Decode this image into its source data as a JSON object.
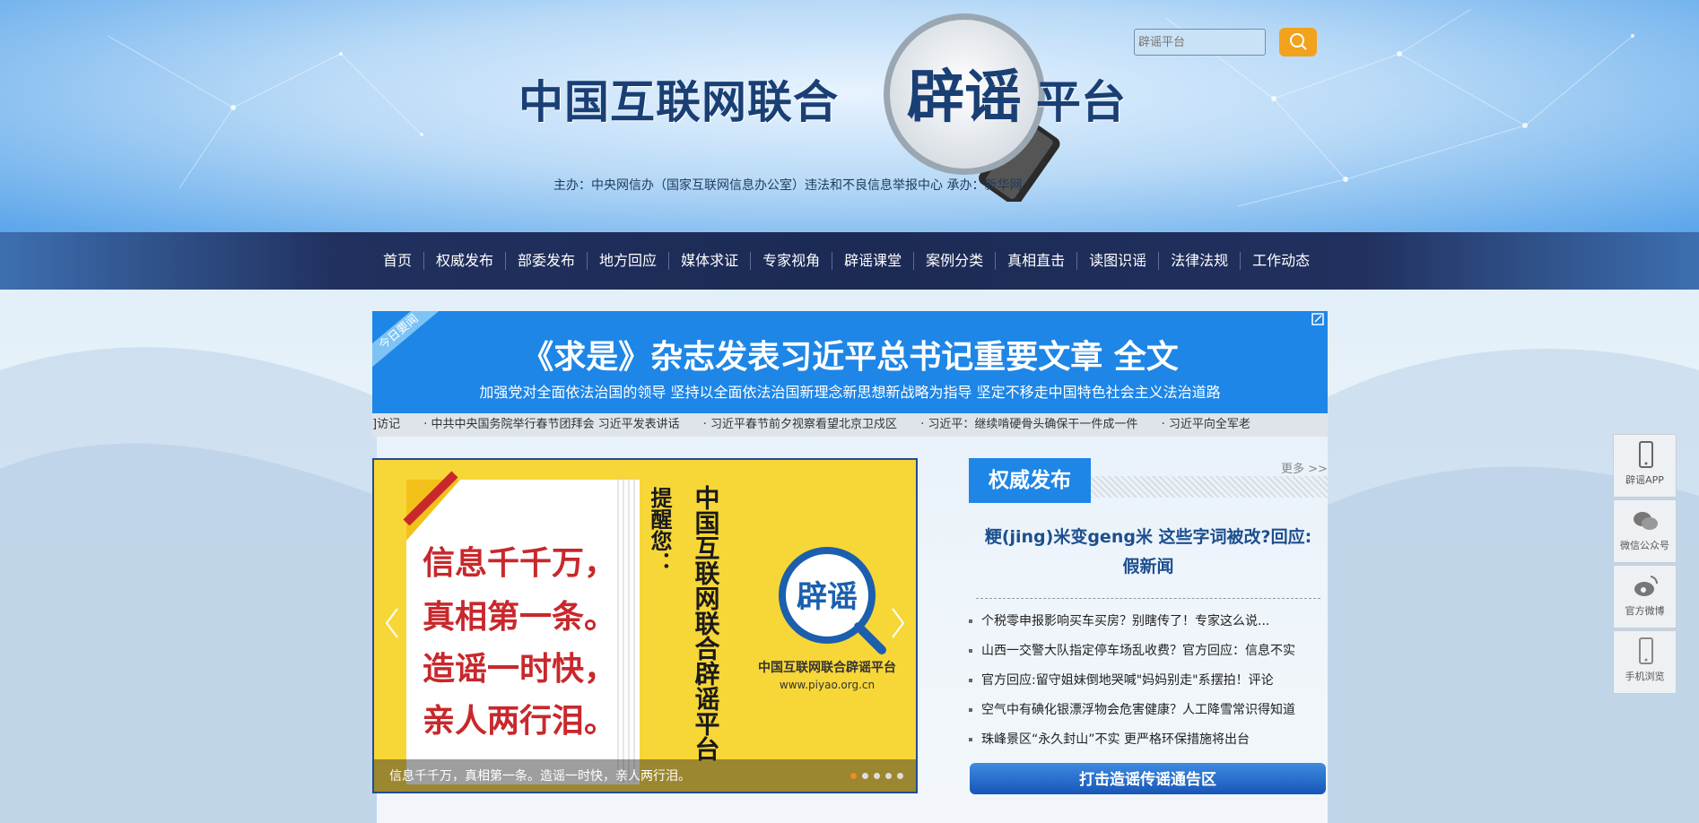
{
  "header": {
    "logo_left": "中国互联网联合",
    "logo_mid": "辟谣",
    "logo_right": "平台",
    "sponsor": "主办：中央网信办（国家互联网信息办公室）违法和不良信息举报中心    承办：新华网",
    "search_placeholder": "辟谣平台"
  },
  "nav": {
    "items": [
      "首页",
      "权威发布",
      "部委发布",
      "地方回应",
      "媒体求证",
      "专家视角",
      "辟谣课堂",
      "案例分类",
      "真相直击",
      "读图识谣",
      "法律法规",
      "工作动态"
    ]
  },
  "headline": {
    "ribbon": "今日要闻",
    "title": "《求是》杂志发表习近平总书记重要文章 全文",
    "subtitle": "加强党对全面依法治国的领导 坚持以全面依法治国新理念新思想新战略为指导 坚定不移走中国特色社会主义法治道路"
  },
  "ticker": {
    "items": [
      "]访记",
      "·  中共中央国务院举行春节团拜会 习近平发表讲话",
      "·  习近平春节前夕视察看望北京卫戍区",
      "·  习近平：继续啃硬骨头确保干一件成一件",
      "·  习近平向全军老"
    ]
  },
  "slider": {
    "caption": "信息千千万，真相第一条。造谣一时快，亲人两行泪。",
    "poster_lines": [
      "信息千千万，",
      "真相第一条。",
      "造谣一时快，",
      "亲人两行泪。"
    ],
    "reminder": "提醒您：",
    "vertical_org": "中国互联网联合辟谣平台",
    "badge": "辟谣",
    "badge_org": "中国互联网联合辟谣平台",
    "badge_url": "www.piyao.org.cn",
    "active_dot": 0,
    "dot_count": 5
  },
  "authority": {
    "tab": "权威发布",
    "more": "更多 >>",
    "feature": "粳(jing)米变geng米 这些字词被改?回应: 假新闻",
    "items": [
      "个税零申报影响买车买房？别瞎传了！专家这么说...",
      "山西一交警大队指定停车场乱收费？官方回应：信息不实",
      "官方回应:留守姐妹倒地哭喊\"妈妈别走\"系摆拍！评论",
      "空气中有碘化银漂浮物会危害健康？人工降雪常识得知道",
      "珠峰景区“永久封山”不实 更严格环保措施将出台"
    ],
    "notice": "打击造谣传谣通告区"
  },
  "side_tools": [
    "辟谣APP",
    "微信公众号",
    "官方微博",
    "手机浏览"
  ],
  "colors": {
    "nav_bg": "#1c2a55",
    "accent_blue": "#1e86e6",
    "search_orange": "#f2a21d",
    "poster_yellow": "#f7d637"
  }
}
